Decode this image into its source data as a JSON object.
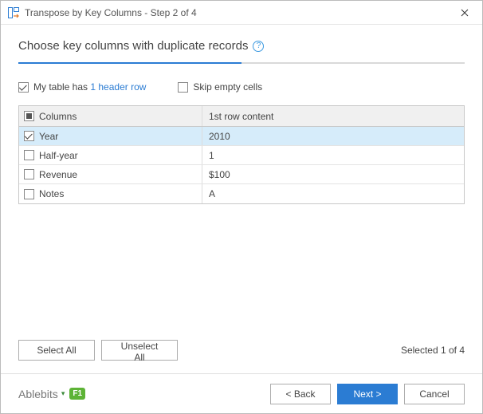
{
  "window": {
    "title": "Transpose by Key Columns - Step 2 of 4"
  },
  "heading": "Choose key columns with duplicate records",
  "progress_percent": 50,
  "options": {
    "header_row": {
      "prefix": "My table has ",
      "link": "1 header row",
      "checked": true
    },
    "skip_empty": {
      "label": "Skip empty cells",
      "checked": false
    }
  },
  "table": {
    "header_select_state": "mixed",
    "col1_header": "Columns",
    "col2_header": "1st row content",
    "rows": [
      {
        "checked": true,
        "name": "Year",
        "content": "2010"
      },
      {
        "checked": false,
        "name": "Half-year",
        "content": "1"
      },
      {
        "checked": false,
        "name": "Revenue",
        "content": "$100"
      },
      {
        "checked": false,
        "name": "Notes",
        "content": "A"
      }
    ]
  },
  "buttons": {
    "select_all": "Select All",
    "unselect_all": "Unselect All",
    "back": "< Back",
    "next": "Next >",
    "cancel": "Cancel"
  },
  "status": "Selected 1 of 4",
  "brand": "Ablebits",
  "help_key": "F1"
}
